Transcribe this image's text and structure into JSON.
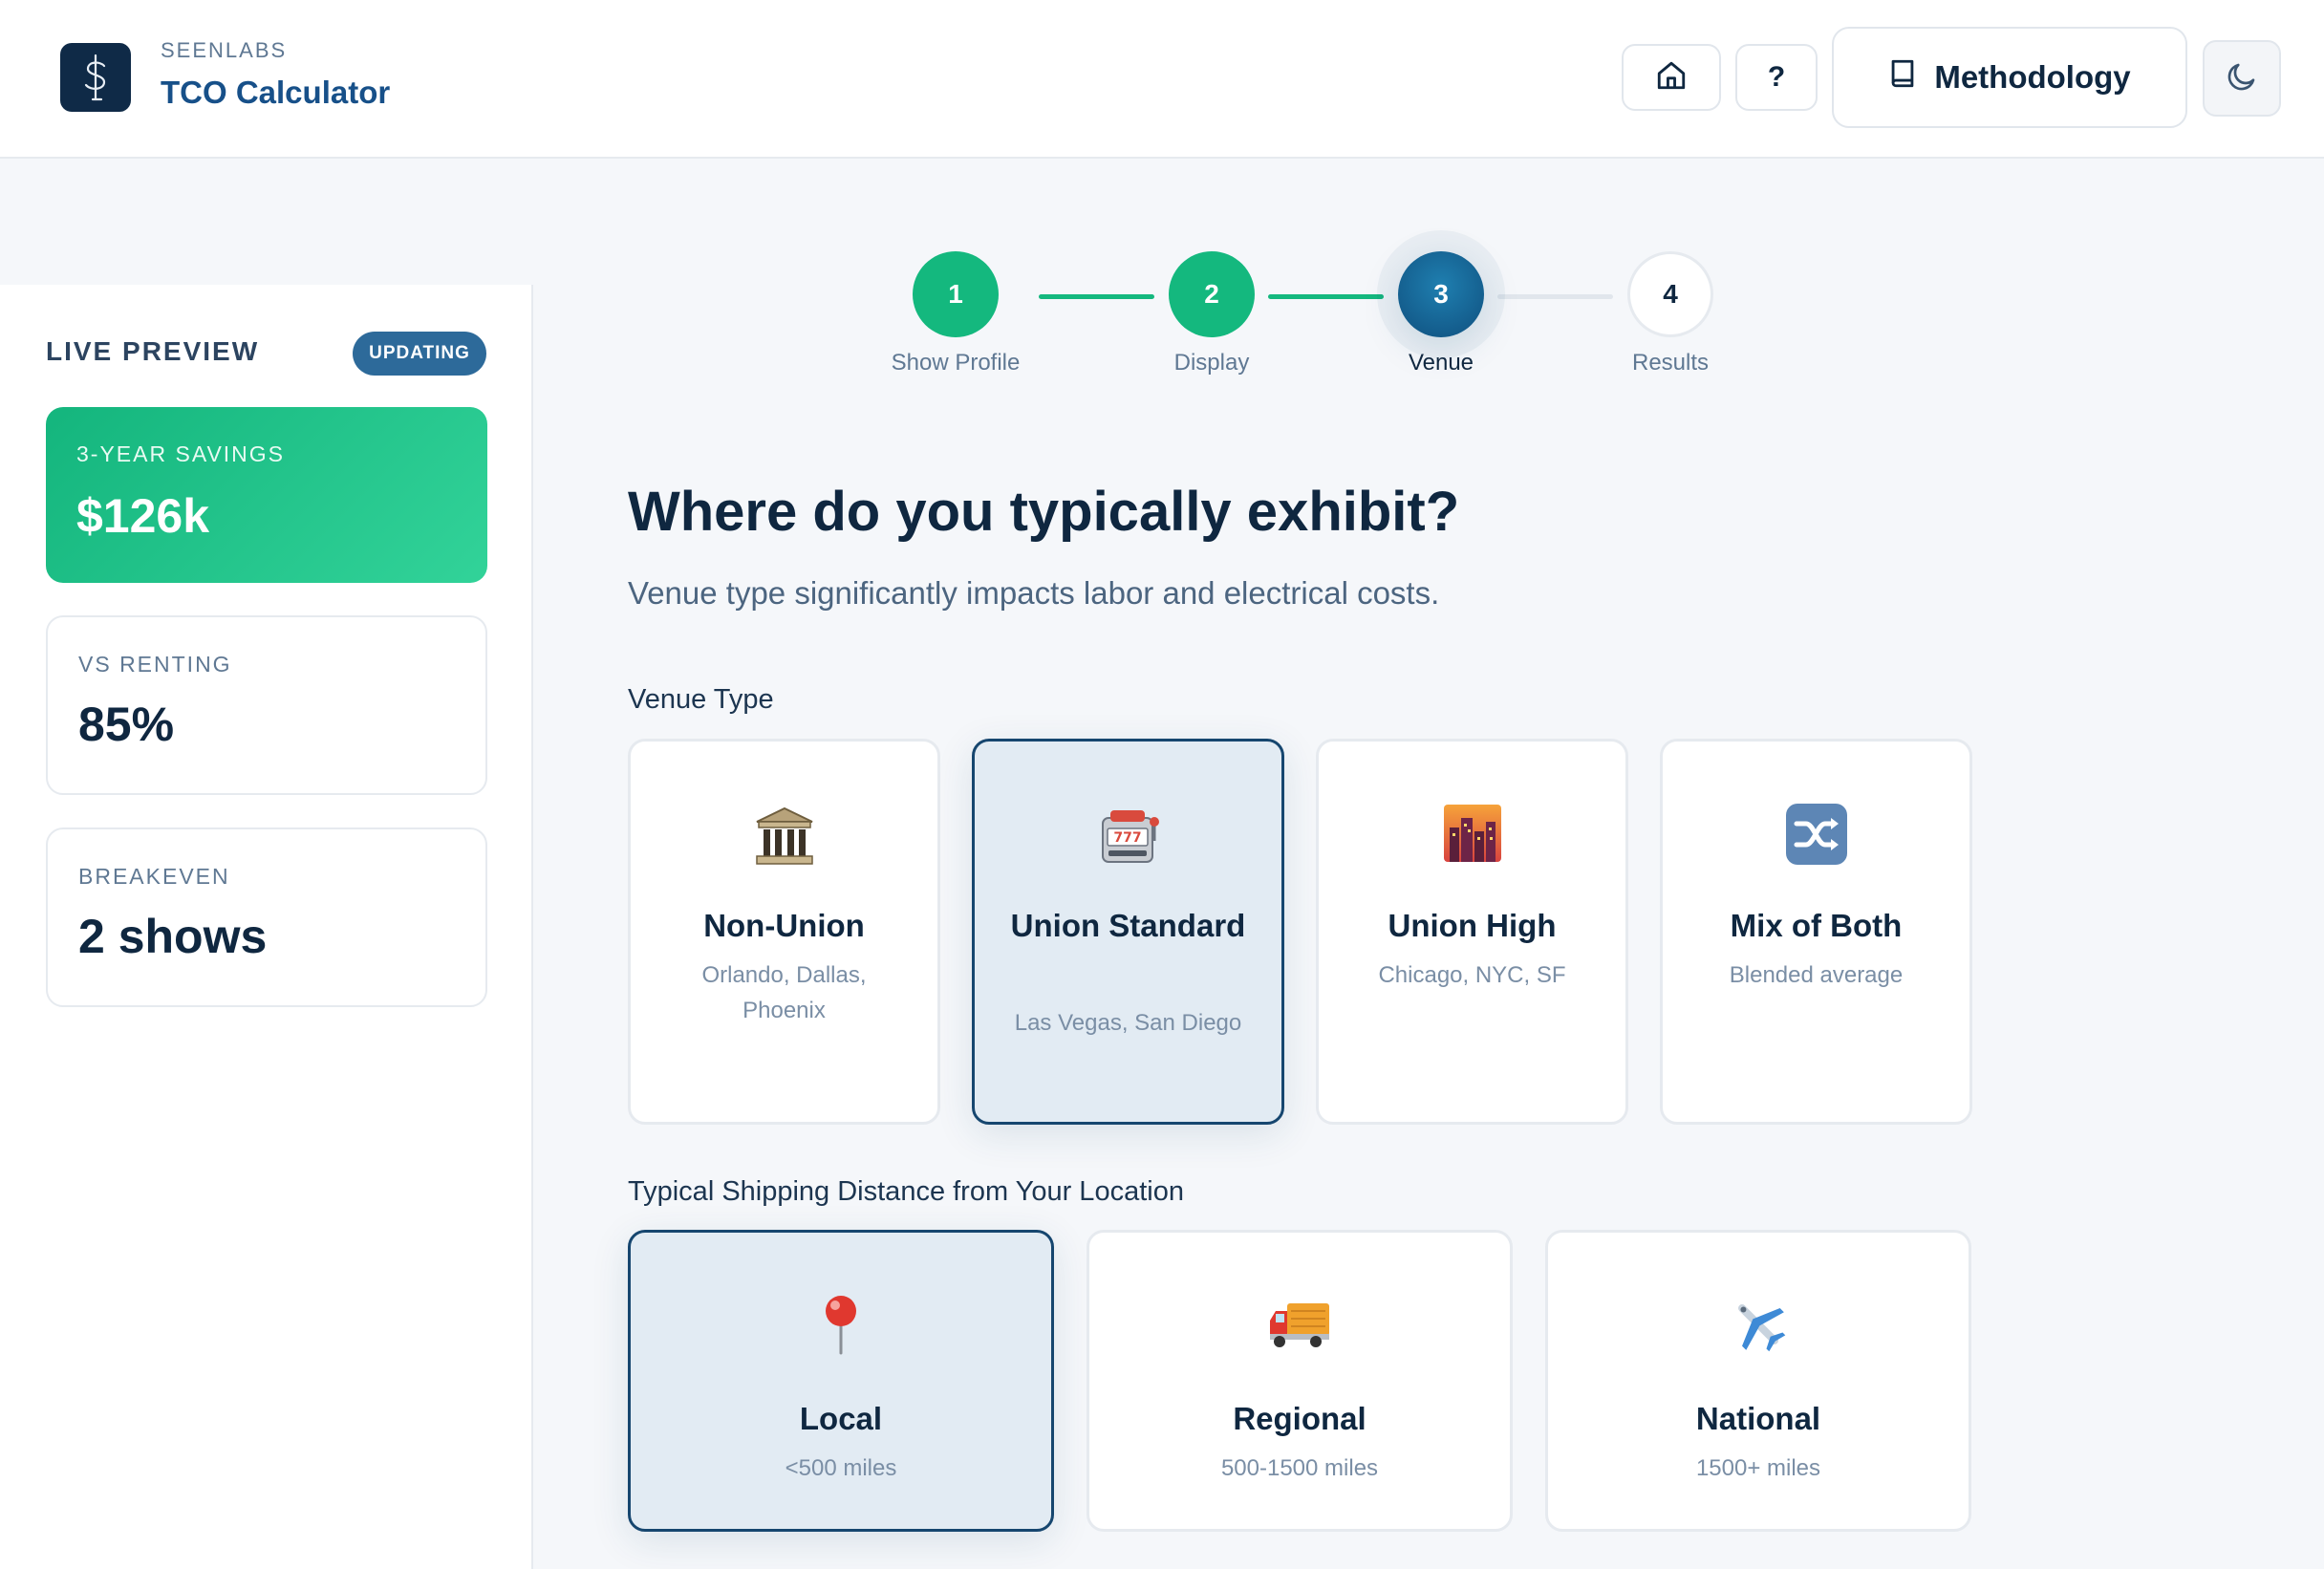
{
  "header": {
    "brand_kicker": "SEENLABS",
    "brand_title": "TCO Calculator",
    "methodology_label": "Methodology",
    "help_label": "?",
    "icons": [
      "dollar-logo-icon",
      "home-icon",
      "book-icon",
      "moon-icon"
    ]
  },
  "sidebar": {
    "title": "LIVE PREVIEW",
    "badge": "UPDATING",
    "stats": [
      {
        "label": "3-YEAR SAVINGS",
        "value": "$126k"
      },
      {
        "label": "VS RENTING",
        "value": "85%"
      },
      {
        "label": "BREAKEVEN",
        "value": "2 shows"
      }
    ]
  },
  "stepper": {
    "steps": [
      {
        "number": "1",
        "label": "Show Profile",
        "state": "done"
      },
      {
        "number": "2",
        "label": "Display",
        "state": "done"
      },
      {
        "number": "3",
        "label": "Venue",
        "state": "active"
      },
      {
        "number": "4",
        "label": "Results",
        "state": "todo"
      }
    ]
  },
  "main": {
    "title": "Where do you typically exhibit?",
    "subtitle": "Venue type significantly impacts labor and electrical costs.",
    "venue_label": "Venue Type",
    "venues": [
      {
        "name": "Non-Union",
        "desc": "Orlando, Dallas, Phoenix",
        "icon": "classical-building-icon",
        "selected": false
      },
      {
        "name": "Union Standard",
        "desc": "Las Vegas, San Diego",
        "icon": "slot-machine-icon",
        "selected": true
      },
      {
        "name": "Union High",
        "desc": "Chicago, NYC, SF",
        "icon": "city-dusk-icon",
        "selected": false
      },
      {
        "name": "Mix of Both",
        "desc": "Blended average",
        "icon": "shuffle-icon",
        "selected": false
      }
    ],
    "shipping_label": "Typical Shipping Distance from Your Location",
    "shipping": [
      {
        "name": "Local",
        "desc": "<500 miles",
        "icon": "pushpin-icon",
        "selected": true
      },
      {
        "name": "Regional",
        "desc": "500-1500 miles",
        "icon": "delivery-truck-icon",
        "selected": false
      },
      {
        "name": "National",
        "desc": "1500+ miles",
        "icon": "airplane-icon",
        "selected": false
      }
    ]
  },
  "colors": {
    "accent_green": "#14b87e",
    "accent_navy": "#16466f",
    "brand_blue": "#175089",
    "text_dark": "#0f2740"
  }
}
